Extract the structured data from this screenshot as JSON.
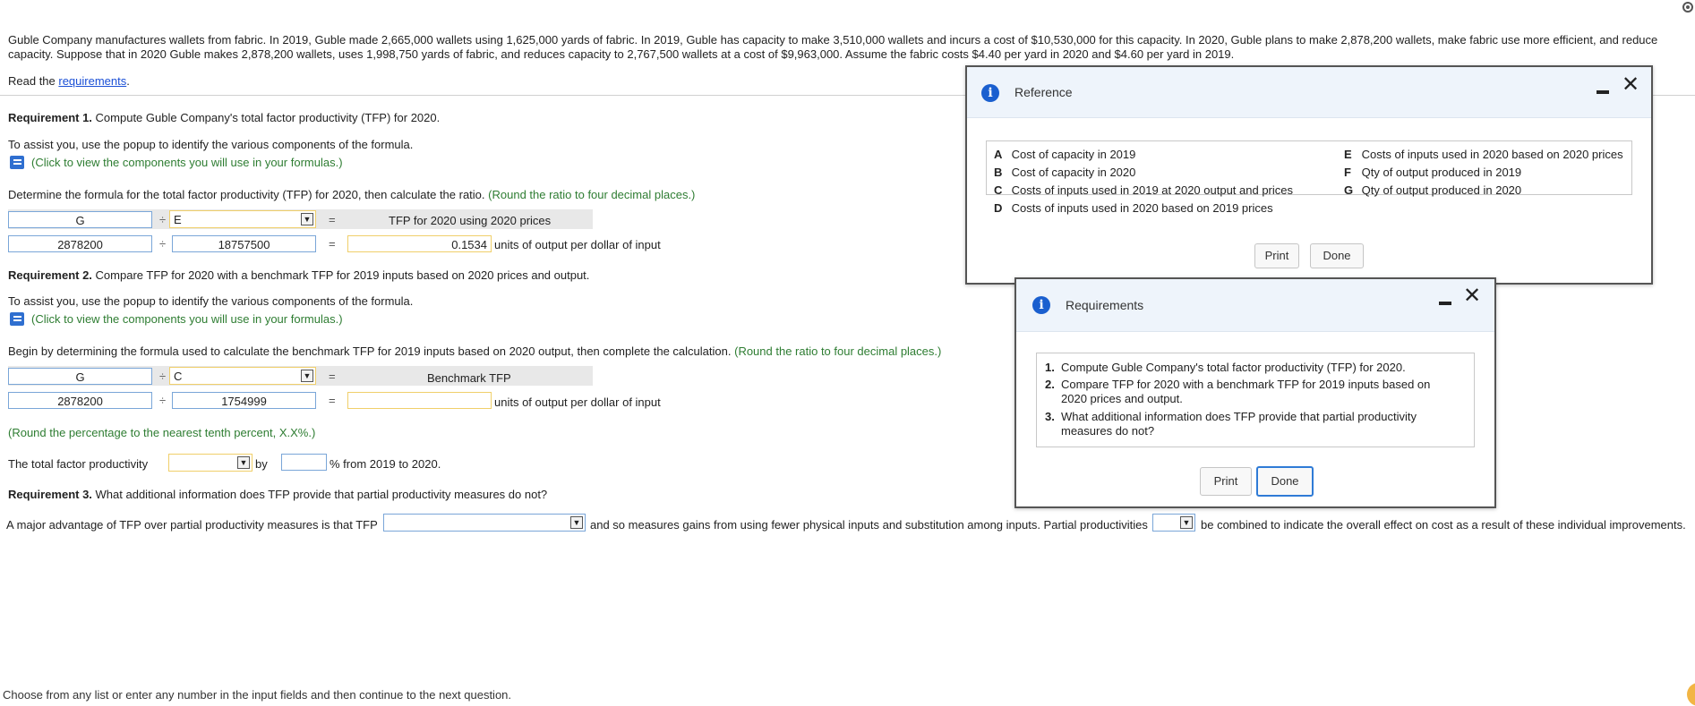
{
  "problem": {
    "line1": "Guble Company manufactures wallets from fabric. In 2019, Guble made 2,665,000 wallets using 1,625,000 yards of fabric. In 2019, Guble has capacity to make 3,510,000 wallets and incurs a cost of $10,530,000 for this capacity. In 2020, Guble plans to make 2,878,200 wallets, make fabric use more efficient, and reduce",
    "line2": "capacity. Suppose that in 2020 Guble makes 2,878,200 wallets, uses 1,998,750 yards of fabric, and reduces capacity to 2,767,500 wallets at a cost of $9,963,000. Assume the fabric costs $4.40 per yard in 2020 and $4.60 per yard in 2019.",
    "read_prefix": "Read the ",
    "read_link": "requirements",
    "read_suffix": "."
  },
  "req1": {
    "heading_bold": "Requirement 1.",
    "heading_rest": " Compute Guble Company's total factor productivity (TFP) for 2020.",
    "assist": "To assist you, use the popup to identify the various components of the formula.",
    "click_link": "(Click to view the components you will use in your formulas.)",
    "determine": "Determine the formula for the total factor productivity (TFP) for 2020, then calculate the ratio.",
    "round_note": "(Round the ratio to four decimal places.)",
    "numerator_label": "G",
    "divide": "÷",
    "denominator_select": "E",
    "equals": "=",
    "result_label": "TFP for 2020 using 2020 prices",
    "numerator_value": "2878200",
    "denominator_value": "18757500",
    "result_value": "0.1534",
    "units": "units of output per dollar of input"
  },
  "req2": {
    "heading_bold": "Requirement 2.",
    "heading_rest": " Compare TFP for 2020 with a benchmark TFP for 2019 inputs based on 2020 prices and output.",
    "assist": "To assist you, use the popup to identify the various components of the formula.",
    "click_link": "(Click to view the components you will use in your formulas.)",
    "begin": "Begin by determining the formula used to calculate the benchmark TFP for 2019 inputs based on 2020 output, then complete the calculation.",
    "round_note": "(Round the ratio to four decimal places.)",
    "numerator_label": "G",
    "denominator_select": "C",
    "result_label": "Benchmark TFP",
    "numerator_value": "2878200",
    "denominator_value": "1754999",
    "result_value": "",
    "units": "units of output per dollar of input",
    "round_pct": "(Round the percentage to the nearest tenth percent, X.X%.)",
    "tfp_prefix": "The total factor productivity",
    "tfp_by": "by",
    "tfp_suffix": "% from 2019 to 2020.",
    "tfp_select_value": "",
    "tfp_pct_value": ""
  },
  "req3": {
    "heading_bold": "Requirement 3.",
    "heading_rest": " What additional information does TFP provide that partial productivity measures do not?",
    "sentence_a": "A major advantage of TFP over partial productivity measures is that TFP",
    "sentence_b": "and so measures gains from using fewer physical inputs and substitution among inputs. Partial productivities",
    "sentence_c": "be combined to indicate the overall effect on cost as a result of these individual improvements.",
    "select1_value": "",
    "select2_value": ""
  },
  "footer": {
    "instruction": "Choose from any list or enter any number in the input fields and then continue to the next question."
  },
  "reference_dialog": {
    "title": "Reference",
    "items_left": [
      {
        "key": "A",
        "text": "Cost of capacity in 2019"
      },
      {
        "key": "B",
        "text": "Cost of capacity in 2020"
      },
      {
        "key": "C",
        "text": "Costs of inputs used in 2019 at 2020 output and prices"
      },
      {
        "key": "D",
        "text": "Costs of inputs used in 2020 based on 2019 prices"
      }
    ],
    "items_right": [
      {
        "key": "E",
        "text": "Costs of inputs used in 2020 based on 2020 prices"
      },
      {
        "key": "F",
        "text": "Qty of output produced in 2019"
      },
      {
        "key": "G",
        "text": "Qty of output produced in 2020"
      }
    ],
    "print_label": "Print",
    "done_label": "Done"
  },
  "requirements_dialog": {
    "title": "Requirements",
    "items": [
      {
        "num": "1.",
        "text": "Compute Guble Company's total factor productivity (TFP) for 2020."
      },
      {
        "num": "2.",
        "text": "Compare TFP for 2020 with a benchmark TFP for 2019 inputs based on 2020 prices and output."
      },
      {
        "num": "3.",
        "text": "What additional information does TFP provide that partial productivity measures do not?"
      }
    ],
    "print_label": "Print",
    "done_label": "Done"
  },
  "icons": {
    "book": "book-icon",
    "info": "info-icon",
    "dropdown": "dropdown-arrow-icon",
    "minimize": "minimize-icon",
    "close": "close-icon",
    "settings": "gear-icon"
  }
}
